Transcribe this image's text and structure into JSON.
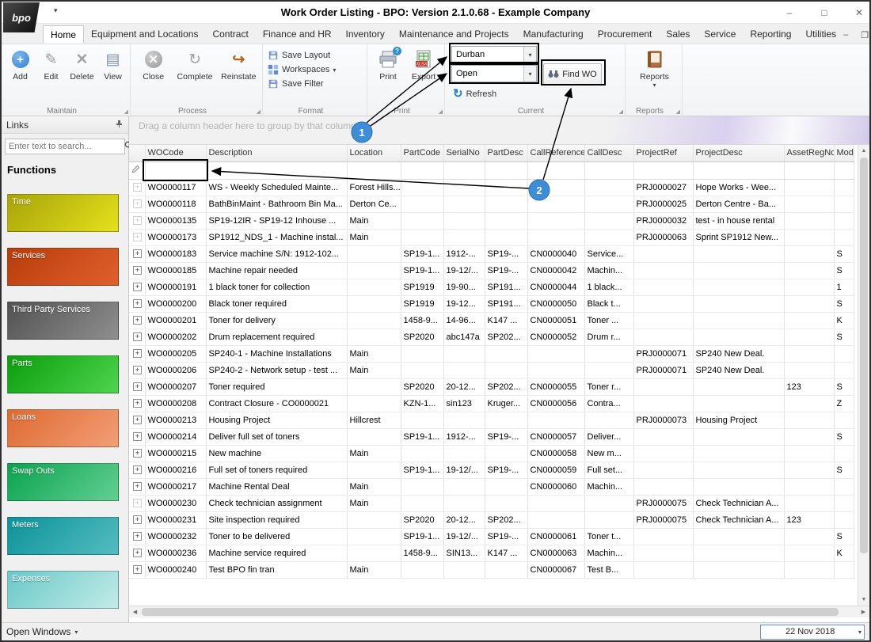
{
  "window": {
    "title": "Work Order Listing - BPO: Version 2.1.0.68 - Example Company",
    "logo_text": "bpo"
  },
  "ribbon": {
    "tabs": [
      {
        "label": "Home",
        "active": true
      },
      {
        "label": "Equipment and Locations"
      },
      {
        "label": "Contract"
      },
      {
        "label": "Finance and HR"
      },
      {
        "label": "Inventory"
      },
      {
        "label": "Maintenance and Projects"
      },
      {
        "label": "Manufacturing"
      },
      {
        "label": "Procurement"
      },
      {
        "label": "Sales"
      },
      {
        "label": "Service"
      },
      {
        "label": "Reporting"
      },
      {
        "label": "Utilities"
      }
    ],
    "maintain": {
      "label": "Maintain",
      "add": "Add",
      "edit": "Edit",
      "delete": "Delete",
      "view": "View"
    },
    "process": {
      "label": "Process",
      "close": "Close",
      "complete": "Complete",
      "reinstate": "Reinstate"
    },
    "format": {
      "label": "Format",
      "save_layout": "Save Layout",
      "workspaces": "Workspaces",
      "save_filter": "Save Filter"
    },
    "print": {
      "label": "Print",
      "print": "Print",
      "export": "Export"
    },
    "current": {
      "label": "Current",
      "site": "Durban",
      "status": "Open",
      "find": "Find WO",
      "refresh": "Refresh"
    },
    "reports": {
      "label": "Reports",
      "button": "Reports"
    }
  },
  "sidebar": {
    "header": "Links",
    "search_placeholder": "Enter text to search...",
    "section": "Functions",
    "tiles": [
      {
        "label": "Time",
        "from": "#a8a409",
        "to": "#e4e01d"
      },
      {
        "label": "Services",
        "from": "#b93c0c",
        "to": "#e0602c"
      },
      {
        "label": "Third Party Services",
        "from": "#525252",
        "to": "#8f8f8f"
      },
      {
        "label": "Parts",
        "from": "#0b9e0b",
        "to": "#4fd44f"
      },
      {
        "label": "Loans",
        "from": "#df6a31",
        "to": "#f29e78"
      },
      {
        "label": "Swap Outs",
        "from": "#0aa34f",
        "to": "#63cf93"
      },
      {
        "label": "Meters",
        "from": "#0b9399",
        "to": "#54bcc0"
      },
      {
        "label": "Expenses",
        "from": "#6ac9c9",
        "to": "#c2ebe7"
      }
    ]
  },
  "grid": {
    "group_by_hint": "Drag a column header here to group by that column",
    "columns": [
      "WOCode",
      "Description",
      "Location",
      "PartCode",
      "SerialNo",
      "PartDesc",
      "CallReference",
      "CallDesc",
      "ProjectRef",
      "ProjectDesc",
      "AssetRegNo",
      "Model"
    ],
    "rows": [
      {
        "muted": true,
        "wocode": "WO0000117",
        "description": "WS - Weekly Scheduled Mainte...",
        "location": "Forest Hills...",
        "projectref": "PRJ0000027",
        "projectdesc": "Hope Works - Wee..."
      },
      {
        "muted": true,
        "wocode": "WO0000118",
        "description": "BathBinMaint - Bathroom Bin Ma...",
        "location": "Derton Ce...",
        "projectref": "PRJ0000025",
        "projectdesc": "Derton Centre - Ba..."
      },
      {
        "muted": true,
        "wocode": "WO0000135",
        "description": "SP19-12IR - SP19-12 Inhouse ...",
        "location": "Main",
        "projectref": "PRJ0000032",
        "projectdesc": "test - in house rental"
      },
      {
        "muted": true,
        "wocode": "WO0000173",
        "description": "SP1912_NDS_1 - Machine instal...",
        "location": "Main",
        "projectref": "PRJ0000063",
        "projectdesc": "Sprint SP1912 New..."
      },
      {
        "wocode": "WO0000183",
        "description": "Service machine S/N: 1912-102...",
        "partcode": "SP19-1...",
        "serialno": "1912-...",
        "partdesc": "SP19-...",
        "callref": "CN0000040",
        "calldesc": "Service...",
        "model": "S"
      },
      {
        "wocode": "WO0000185",
        "description": "Machine repair needed",
        "partcode": "SP19-1...",
        "serialno": "19-12/...",
        "partdesc": "SP19-...",
        "callref": "CN0000042",
        "calldesc": "Machin...",
        "model": "S"
      },
      {
        "wocode": "WO0000191",
        "description": "1 black toner for collection",
        "partcode": "SP1919",
        "serialno": "19-90...",
        "partdesc": "SP191...",
        "callref": "CN0000044",
        "calldesc": "1 black...",
        "model": "1"
      },
      {
        "wocode": "WO0000200",
        "description": "Black toner required",
        "partcode": "SP1919",
        "serialno": "19-12...",
        "partdesc": "SP191...",
        "callref": "CN0000050",
        "calldesc": "Black t...",
        "model": "S"
      },
      {
        "wocode": "WO0000201",
        "description": "Toner for delivery",
        "partcode": "1458-9...",
        "serialno": "14-96...",
        "partdesc": "K147 ...",
        "callref": "CN0000051",
        "calldesc": "Toner ...",
        "model": "K"
      },
      {
        "wocode": "WO0000202",
        "description": "Drum replacement required",
        "partcode": "SP2020",
        "serialno": "abc147a",
        "partdesc": "SP202...",
        "callref": "CN0000052",
        "calldesc": "Drum r...",
        "model": "S"
      },
      {
        "wocode": "WO0000205",
        "description": "SP240-1 - Machine Installations",
        "location": "Main",
        "projectref": "PRJ0000071",
        "projectdesc": "SP240 New Deal."
      },
      {
        "wocode": "WO0000206",
        "description": "SP240-2 - Network setup - test ...",
        "location": "Main",
        "projectref": "PRJ0000071",
        "projectdesc": "SP240 New Deal."
      },
      {
        "wocode": "WO0000207",
        "description": "Toner required",
        "partcode": "SP2020",
        "serialno": "20-12...",
        "partdesc": "SP202...",
        "callref": "CN0000055",
        "calldesc": "Toner r...",
        "assetregno": "123",
        "model": "S"
      },
      {
        "wocode": "WO0000208",
        "description": "Contract Closure - CO0000021",
        "partcode": "KZN-1...",
        "serialno": "sin123",
        "partdesc": "Kruger...",
        "callref": "CN0000056",
        "calldesc": "Contra...",
        "model": "Z"
      },
      {
        "wocode": "WO0000213",
        "description": "Housing Project",
        "location": "Hillcrest",
        "projectref": "PRJ0000073",
        "projectdesc": "Housing Project"
      },
      {
        "wocode": "WO0000214",
        "description": "Deliver full set of toners",
        "partcode": "SP19-1...",
        "serialno": "1912-...",
        "partdesc": "SP19-...",
        "callref": "CN0000057",
        "calldesc": "Deliver...",
        "model": "S"
      },
      {
        "wocode": "WO0000215",
        "description": "New machine",
        "location": "Main",
        "callref": "CN0000058",
        "calldesc": "New m..."
      },
      {
        "wocode": "WO0000216",
        "description": "Full set of toners required",
        "partcode": "SP19-1...",
        "serialno": "19-12/...",
        "partdesc": "SP19-...",
        "callref": "CN0000059",
        "calldesc": "Full set...",
        "model": "S"
      },
      {
        "wocode": "WO0000217",
        "description": "Machine Rental Deal",
        "location": "Main",
        "callref": "CN0000060",
        "calldesc": "Machin..."
      },
      {
        "muted": true,
        "wocode": "WO0000230",
        "description": "Check technician assignment",
        "location": "Main",
        "projectref": "PRJ0000075",
        "projectdesc": "Check Technician A..."
      },
      {
        "wocode": "WO0000231",
        "description": "Site inspection required",
        "partcode": "SP2020",
        "serialno": "20-12...",
        "partdesc": "SP202...",
        "projectref": "PRJ0000075",
        "projectdesc": "Check Technician A...",
        "assetregno": "123"
      },
      {
        "wocode": "WO0000232",
        "description": "Toner to be delivered",
        "partcode": "SP19-1...",
        "serialno": "19-12/...",
        "partdesc": "SP19-...",
        "callref": "CN0000061",
        "calldesc": "Toner t...",
        "model": "S"
      },
      {
        "wocode": "WO0000236",
        "description": "Machine service required",
        "partcode": "1458-9...",
        "serialno": "SIN13...",
        "partdesc": "K147 ...",
        "callref": "CN0000063",
        "calldesc": "Machin...",
        "model": "K"
      },
      {
        "wocode": "WO0000240",
        "description": "Test BPO fin tran",
        "location": "Main",
        "callref": "CN0000067",
        "calldesc": "Test B..."
      }
    ]
  },
  "statusbar": {
    "open_windows": "Open Windows",
    "date": "22 Nov 2018"
  },
  "annotations": {
    "step1": "1",
    "step2": "2",
    "circle_color": "#3e8ed7"
  }
}
